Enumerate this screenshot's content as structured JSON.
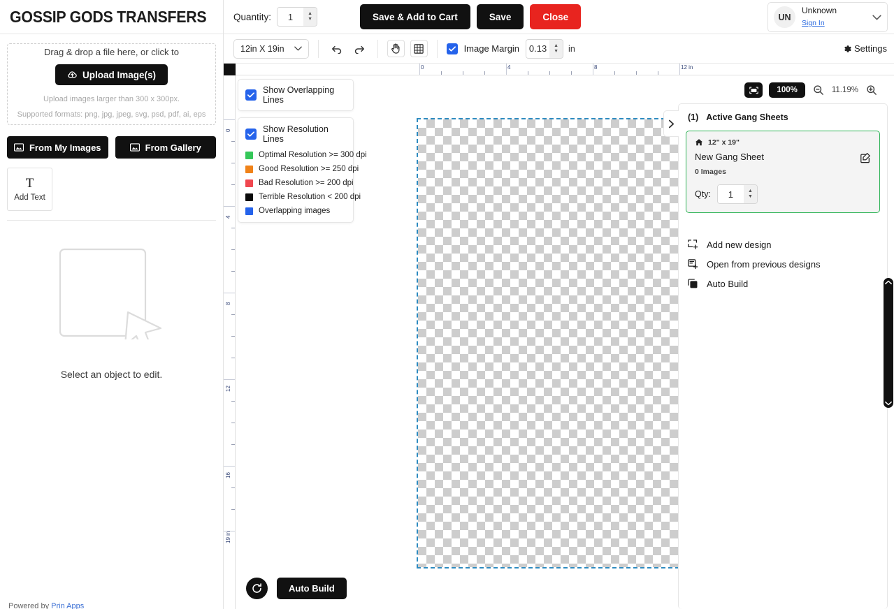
{
  "brand": {
    "title": "GOSSIP GODS TRANSFERS"
  },
  "sidebar": {
    "dropzone": {
      "heading": "Drag & drop a file here, or click to",
      "upload_label": "Upload Image(s)",
      "note_size": "Upload images larger than 300 x 300px.",
      "note_formats": "Supported formats: png, jpg, jpeg, svg, psd, pdf, ai, eps"
    },
    "sources": [
      {
        "label": "From My Images",
        "icon": "image-icon"
      },
      {
        "label": "From Gallery",
        "icon": "image-icon"
      }
    ],
    "tools": [
      {
        "label": "Add Text",
        "glyph": "T",
        "icon": "text-icon"
      }
    ],
    "empty_state": {
      "message": "Select an object to edit.",
      "icon": "cursor-select-icon"
    },
    "footer": {
      "prefix": "Powered by ",
      "link": "Prin Apps"
    }
  },
  "topbar": {
    "quantity_label": "Quantity:",
    "quantity_value": "1",
    "buttons": [
      {
        "label": "Save & Add to Cart",
        "style": "dark"
      },
      {
        "label": "Save",
        "style": "dark"
      },
      {
        "label": "Close",
        "style": "red"
      }
    ],
    "account": {
      "initials": "UN",
      "name": "Unknown",
      "link": "Sign In"
    }
  },
  "toolbar": {
    "size_value": "12in X 19in",
    "undo_icon": "undo-icon",
    "redo_icon": "redo-icon",
    "pan_icon": "hand-pan-icon",
    "grid_icon": "grid-icon",
    "image_margin_label": "Image Margin",
    "image_margin_value": "0.13",
    "image_margin_checked": true,
    "unit": "in",
    "settings_label": "Settings"
  },
  "zoom_controls": {
    "fit_icon": "fit-to-screen-icon",
    "preset_label": "100%",
    "zoom_out_icon": "zoom-out-icon",
    "zoom_in_icon": "zoom-in-icon",
    "current_zoom": "11.19%"
  },
  "rulers": {
    "horizontal_labels": [
      "0",
      "4",
      "8",
      "12 in"
    ],
    "vertical_labels": [
      "0",
      "4",
      "8",
      "12",
      "16",
      "19 in"
    ]
  },
  "legend": {
    "overlapping_toggle": {
      "label": "Show Overlapping Lines",
      "checked": true
    },
    "resolution_toggle": {
      "label": "Show Resolution Lines",
      "checked": true
    },
    "items": [
      {
        "label": "Optimal Resolution >= 300 dpi",
        "color": "#35c759"
      },
      {
        "label": "Good Resolution >= 250 dpi",
        "color": "#f08218"
      },
      {
        "label": "Bad Resolution >= 200 dpi",
        "color": "#f0474f"
      },
      {
        "label": "Terrible Resolution < 200 dpi",
        "color": "#0a0a0a"
      },
      {
        "label": "Overlapping images",
        "color": "#2563eb"
      }
    ]
  },
  "right_panel": {
    "count_badge": "(1)",
    "title": "Active Gang Sheets",
    "collapse_icon": "chevron-right-icon",
    "sheet": {
      "dimensions": "12\" x 19\"",
      "home_icon": "home-icon",
      "name": "New Gang Sheet",
      "images_count": "0 Images",
      "qty_label": "Qty:",
      "qty_value": "1",
      "edit_icon": "edit-icon",
      "border_color": "#2fb457"
    },
    "actions": [
      {
        "label": "Add new design",
        "icon": "add-design-icon"
      },
      {
        "label": "Open from previous designs",
        "icon": "open-previous-icon"
      },
      {
        "label": "Auto Build",
        "icon": "auto-build-icon"
      }
    ]
  },
  "bottom_bar": {
    "refresh_icon": "refresh-icon",
    "auto_build_label": "Auto Build"
  },
  "scrollbar": {
    "up_icon": "chevron-up-icon",
    "down_icon": "chevron-down-icon"
  }
}
